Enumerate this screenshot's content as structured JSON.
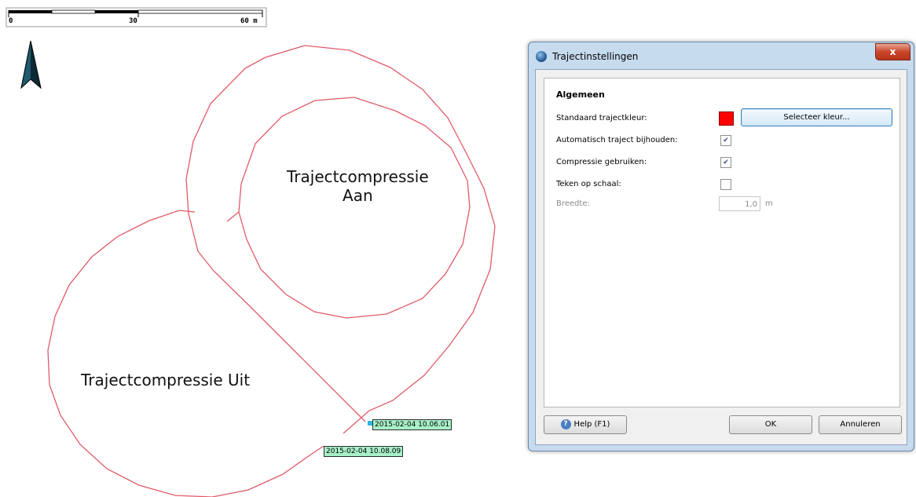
{
  "map": {
    "scale_bar": {
      "labels": [
        "0",
        "30",
        "60 m"
      ]
    },
    "label_compression_on_line1": "Trajectcompressie",
    "label_compression_on_line2": "Aan",
    "label_compression_off": "Trajectcompressie Uit",
    "timestamp_start": "2015-02-04 10.06.01",
    "timestamp_end": "2015-02-04 10.08.09",
    "track_color": "#e05a6a",
    "north_arrow_icon": "north-arrow-icon"
  },
  "dialog": {
    "title": "Trajectinstellingen",
    "close_label": "x",
    "group_title": "Algemeen",
    "rows": {
      "default_color_label": "Standaard trajectkleur:",
      "default_color": "#ff0000",
      "select_color_button": "Selecteer kleur...",
      "auto_track_label": "Automatisch traject bijhouden:",
      "auto_track_checked": true,
      "compression_label": "Compressie gebruiken:",
      "compression_checked": true,
      "draw_to_scale_label": "Teken op schaal:",
      "draw_to_scale_checked": false,
      "width_label": "Breedte:",
      "width_value": "1,0",
      "width_unit": "m"
    },
    "buttons": {
      "help": "Help (F1)",
      "ok": "OK",
      "cancel": "Annuleren"
    }
  }
}
